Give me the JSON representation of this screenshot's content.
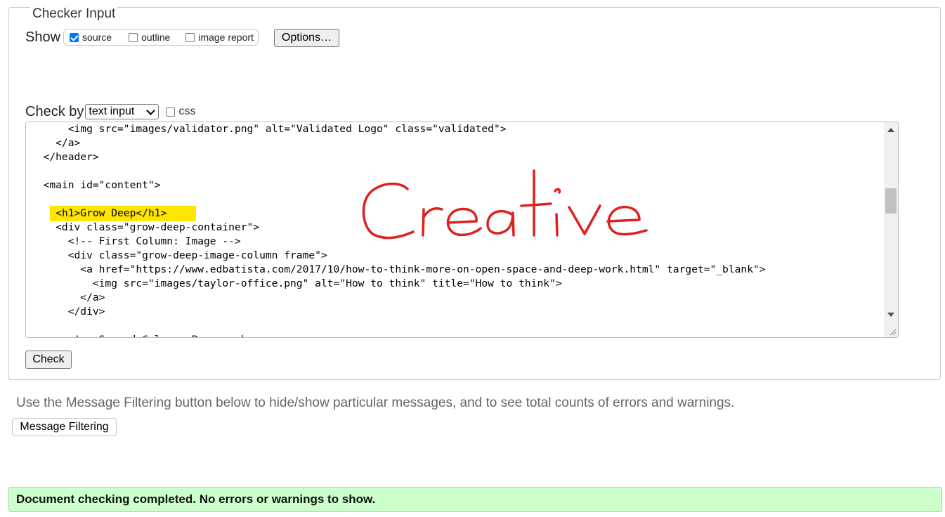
{
  "checker_input": {
    "legend": "Checker Input",
    "show_label": "Show",
    "show_options": [
      {
        "label": "source",
        "checked": true
      },
      {
        "label": "outline",
        "checked": false
      },
      {
        "label": "image report",
        "checked": false
      }
    ],
    "options_button": "Options…",
    "check_by_label": "Check by",
    "check_by_selected": "text input",
    "css_label": "css",
    "css_checked": false,
    "source_lines": [
      "      <img src=\"images/validator.png\" alt=\"Validated Logo\" class=\"validated\">",
      "    </a>",
      "  </header>",
      "",
      "  <main id=\"content\">",
      "",
      "    <h1>Grow Deep</h1>",
      "    <div class=\"grow-deep-container\">",
      "      <!-- First Column: Image -->",
      "      <div class=\"grow-deep-image-column frame\">",
      "        <a href=\"https://www.edbatista.com/2017/10/how-to-think-more-on-open-space-and-deep-work.html\" target=\"_blank\">",
      "          <img src=\"images/taylor-office.png\" alt=\"How to think\" title=\"How to think\">",
      "        </a>",
      "      </div>",
      "",
      "      <!-- Second Column: Paragraphs -->"
    ],
    "highlighted_line_index": 6,
    "highlight_color": "#ffe500",
    "annotation_text": "Creative",
    "annotation_color": "#e01f1f",
    "check_button": "Check"
  },
  "message_filtering": {
    "description": "Use the Message Filtering button below to hide/show particular messages, and to see total counts of errors and warnings.",
    "button": "Message Filtering"
  },
  "status": {
    "text": "Document checking completed. No errors or warnings to show.",
    "color": "#ccffcc"
  }
}
